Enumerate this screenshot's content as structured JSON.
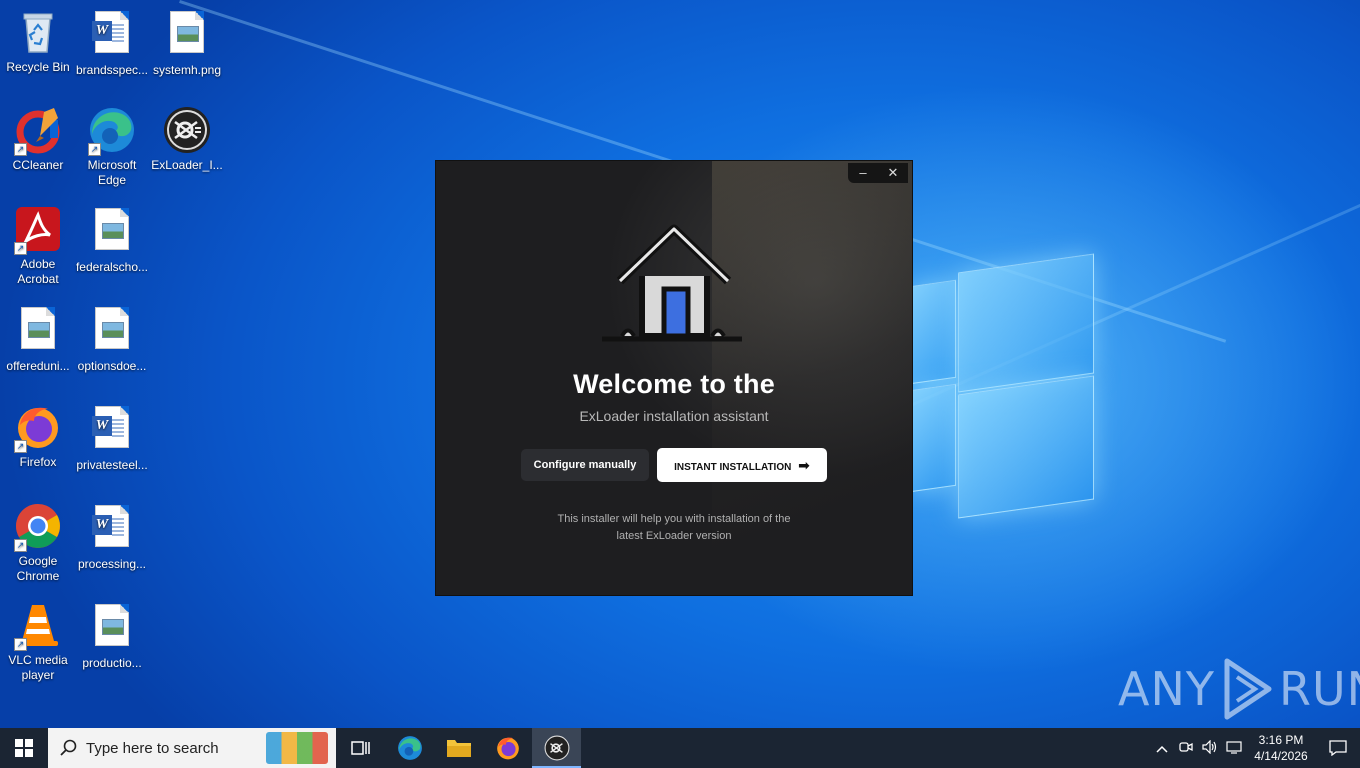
{
  "desktop": {
    "icons": [
      {
        "label": "Recycle Bin",
        "icon": "recycle-bin-icon"
      },
      {
        "label": "brandsspec...",
        "icon": "word-doc-icon"
      },
      {
        "label": "systemh.png",
        "icon": "image-file-icon"
      },
      {
        "label": "CCleaner",
        "icon": "ccleaner-icon"
      },
      {
        "label": "Microsoft Edge",
        "icon": "edge-icon"
      },
      {
        "label": "ExLoader_I...",
        "icon": "exloader-icon"
      },
      {
        "label": "Adobe Acrobat",
        "icon": "acrobat-icon"
      },
      {
        "label": "federalscho...",
        "icon": "image-file-icon"
      },
      {
        "label": "offereduni...",
        "icon": "image-file-icon"
      },
      {
        "label": "optionsdoe...",
        "icon": "image-file-icon"
      },
      {
        "label": "Firefox",
        "icon": "firefox-icon"
      },
      {
        "label": "privatesteel...",
        "icon": "word-doc-icon"
      },
      {
        "label": "Google Chrome",
        "icon": "chrome-icon"
      },
      {
        "label": "processing...",
        "icon": "word-doc-icon"
      },
      {
        "label": "VLC media player",
        "icon": "vlc-icon"
      },
      {
        "label": "productio...",
        "icon": "image-file-icon"
      }
    ]
  },
  "installer": {
    "minimize_label": "‒",
    "close_label": "✕",
    "title": "Welcome to the",
    "subtitle": "ExLoader installation assistant",
    "configure_button": "Configure manually",
    "instant_button": "INSTANT INSTALLATION",
    "instant_arrow": "➡",
    "note_line1": "This installer will help you with installation of the",
    "note_line2": "latest ExLoader version"
  },
  "watermark": {
    "left": "ANY",
    "right": "RUN"
  },
  "taskbar": {
    "search_placeholder": "Type here to search",
    "time": "3:16 PM",
    "date": "4/14/2026"
  },
  "colors": {
    "desktop_blue": "#0a64d6",
    "installer_bg": "#1e1e20",
    "taskbar_bg": "#1b2533",
    "house_door": "#3d6fe0"
  }
}
